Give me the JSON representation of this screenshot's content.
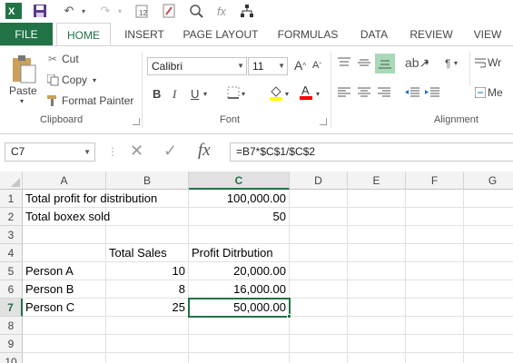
{
  "qat": {
    "save_icon": "save-icon",
    "undo_icon": "undo-icon",
    "redo_icon": "redo-icon"
  },
  "tabs": [
    {
      "label": "FILE"
    },
    {
      "label": "HOME"
    },
    {
      "label": "INSERT"
    },
    {
      "label": "PAGE LAYOUT"
    },
    {
      "label": "FORMULAS"
    },
    {
      "label": "DATA"
    },
    {
      "label": "REVIEW"
    },
    {
      "label": "VIEW"
    }
  ],
  "ribbon": {
    "clipboard": {
      "paste": "Paste",
      "cut": "Cut",
      "copy": "Copy",
      "format_painter": "Format Painter",
      "label": "Clipboard"
    },
    "font": {
      "name": "Calibri",
      "size": "11",
      "bold": "B",
      "italic": "I",
      "underline": "U",
      "label": "Font"
    },
    "alignment": {
      "label": "Alignment",
      "wrap": "Wr",
      "merge": "Me"
    }
  },
  "formula_bar": {
    "name_box": "C7",
    "fx": "fx",
    "formula": "=B7*$C$1/$C$2"
  },
  "columns": [
    "A",
    "B",
    "C",
    "D",
    "E",
    "F",
    "G"
  ],
  "rows": [
    "1",
    "2",
    "3",
    "4",
    "5",
    "6",
    "7",
    "8",
    "9",
    "10"
  ],
  "cells": {
    "A1": "Total profit for distribution",
    "C1": "100,000.00",
    "A2": "Total boxex sold",
    "C2": "50",
    "B4": "Total Sales",
    "C4": "Profit Ditrbution",
    "A5": "Person A",
    "B5": "10",
    "C5": "20,000.00",
    "A6": "Person B",
    "B6": "8",
    "C6": "16,000.00",
    "A7": "Person C",
    "B7": "25",
    "C7": "50,000.00"
  },
  "colors": {
    "accent": "#217346"
  }
}
